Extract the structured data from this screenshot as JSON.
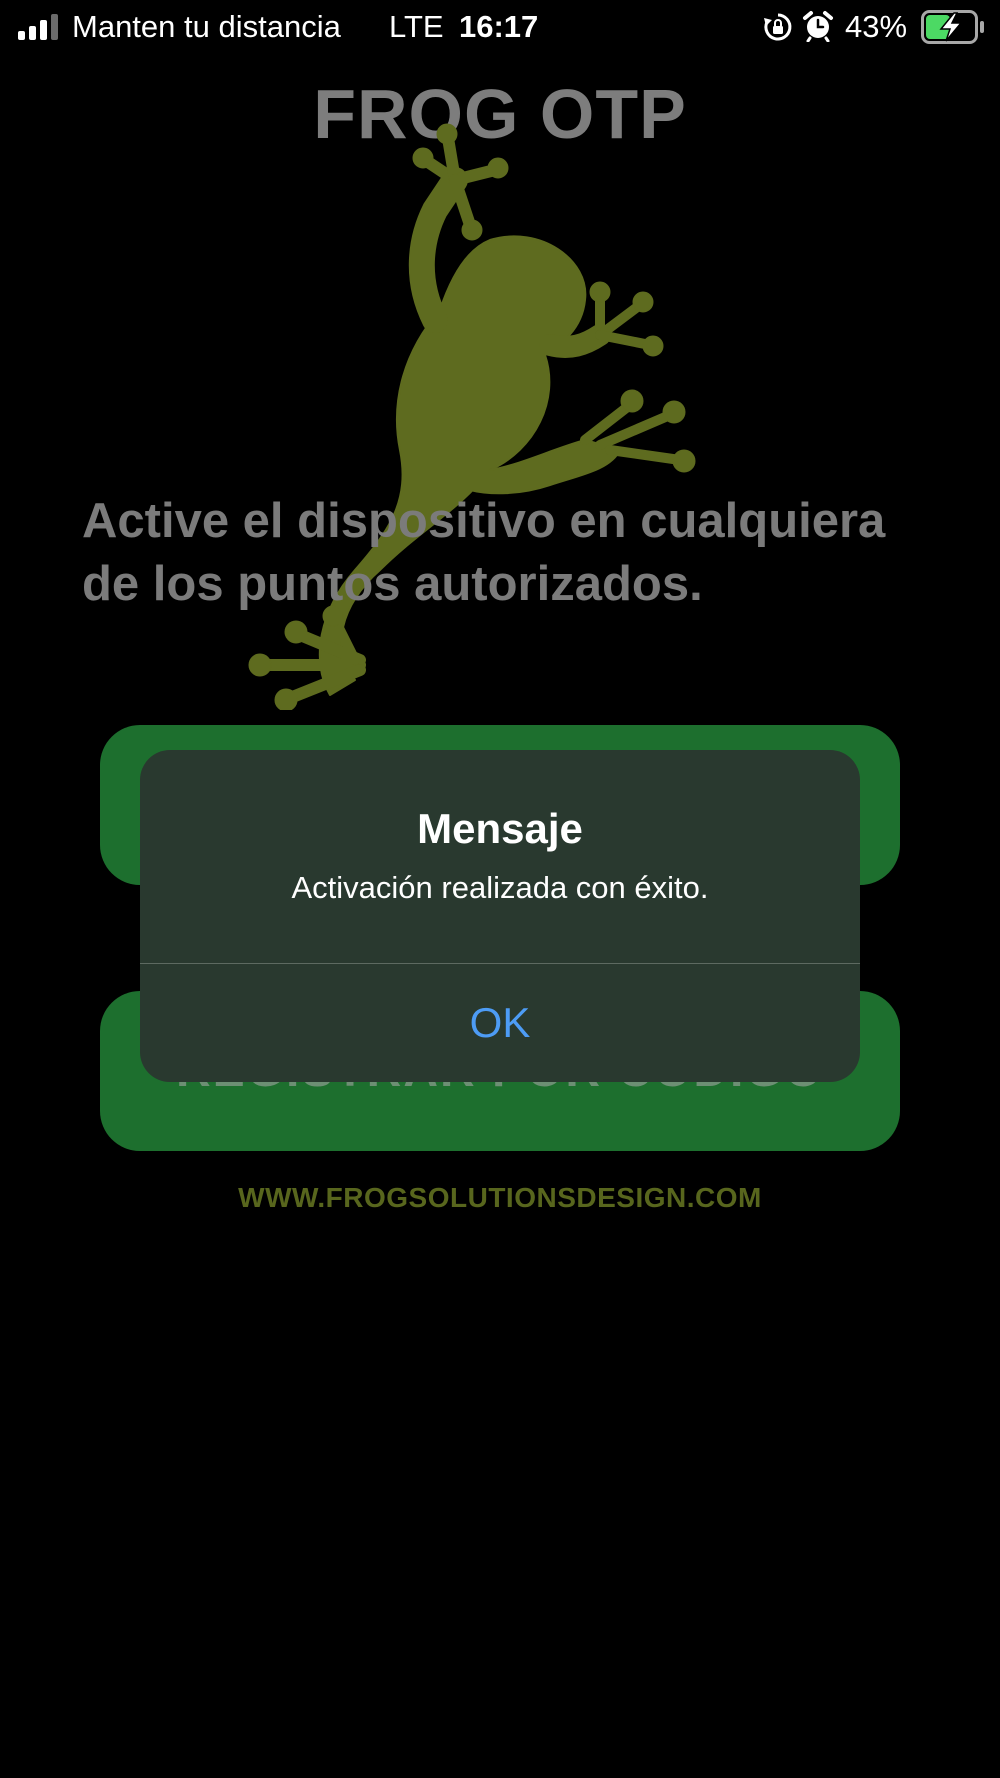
{
  "status_bar": {
    "carrier": "Manten tu distancia",
    "network": "LTE",
    "time": "16:17",
    "battery_percent": "43%",
    "icons": [
      "signal-bars-icon",
      "rotation-lock-icon",
      "alarm-icon",
      "battery-charging-icon"
    ],
    "battery_color": "#4cd964"
  },
  "app": {
    "title": "FROG OTP",
    "instruction": "Active el dispositivo en cualquiera de los puntos autorizados.",
    "register_button_label": "REGISTRAR POR CÓDIGO",
    "website": "WWW.FROGSOLUTIONSDESIGN.COM",
    "logo_icon": "frog-logo-icon",
    "colors": {
      "button_green": "#1d6f2e",
      "frog_olive": "#5e6b1f",
      "website_olive": "#58661d"
    }
  },
  "alert": {
    "title": "Mensaje",
    "message": "Activación realizada con éxito.",
    "ok_label": "OK",
    "colors": {
      "background": "#29392f",
      "ok_text": "#4d9cf5"
    }
  }
}
